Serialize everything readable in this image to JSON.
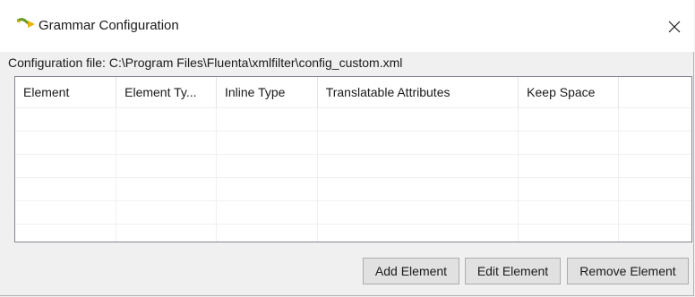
{
  "window": {
    "title": "Grammar Configuration",
    "close_glyph": "✕"
  },
  "config": {
    "text": "Configuration file: C:\\Program Files\\Fluenta\\xmlfilter\\config_custom.xml"
  },
  "table": {
    "columns": [
      "Element",
      "Element Ty...",
      "Inline Type",
      "Translatable Attributes",
      "Keep Space",
      ""
    ],
    "rows": []
  },
  "buttons": {
    "add": "Add Element",
    "edit": "Edit Element",
    "remove": "Remove Element"
  },
  "icons": {
    "app": "fluenta-arrow-icon",
    "close": "close-icon"
  },
  "colors": {
    "icon_green": "#6a9a1e",
    "icon_yellow": "#e8b400",
    "grid_border": "#828790"
  }
}
